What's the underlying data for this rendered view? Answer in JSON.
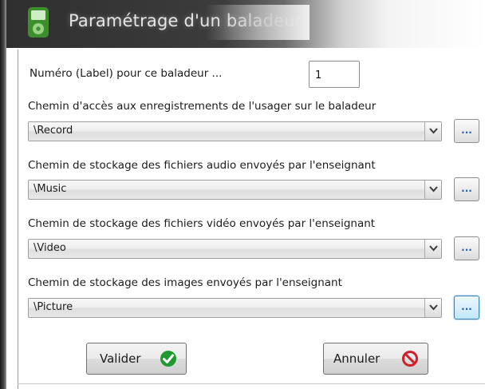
{
  "window": {
    "title": "Paramétrage d'un baladeur"
  },
  "form": {
    "number_label": "Numéro (Label) pour ce baladeur ...",
    "number_value": "1",
    "fields": [
      {
        "label": "Chemin d'accès aux enregistrements de l'usager sur le baladeur",
        "value": "\\Record"
      },
      {
        "label": "Chemin de stockage des fichiers audio envoyés par l'enseignant",
        "value": "\\Music"
      },
      {
        "label": "Chemin de stockage des fichiers vidéo envoyés par l'enseignant",
        "value": "\\Video"
      },
      {
        "label": "Chemin de stockage des images envoyés par l'enseignant",
        "value": "\\Picture"
      }
    ],
    "browse_label": "...",
    "validate_label": "Valider",
    "cancel_label": "Annuler"
  },
  "icons": {
    "app": "mp3-player-icon",
    "validate": "green-check-icon",
    "cancel": "red-prohibited-icon",
    "dropdown": "chevron-down-icon"
  },
  "colors": {
    "validate_icon": "#1f9a2e",
    "cancel_icon": "#d0202a",
    "browse_text": "#2a5fb0",
    "focus_border": "#3c7fb1"
  }
}
